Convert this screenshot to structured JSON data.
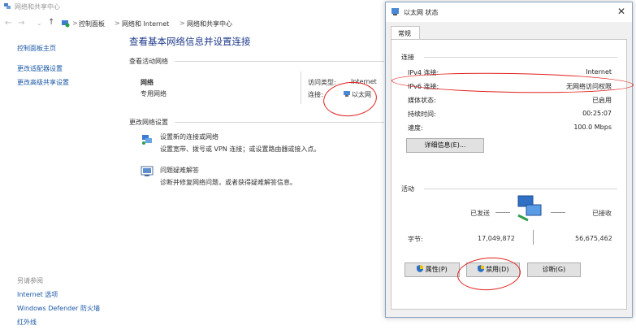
{
  "window": {
    "title": "网络和共享中心"
  },
  "breadcrumb": {
    "items": [
      "控制面板",
      "网络和 Internet",
      "网络和共享中心"
    ],
    "separator": ">"
  },
  "sidebar": {
    "items": [
      {
        "label": "控制面板主页"
      },
      {
        "label": "更改适配器设置"
      },
      {
        "label": "更改高级共享设置"
      }
    ],
    "see_also": {
      "title": "另请参阅",
      "items": [
        {
          "label": "Internet 选项"
        },
        {
          "label": "Windows Defender 防火墙"
        },
        {
          "label": "红外线"
        }
      ]
    }
  },
  "main": {
    "heading": "查看基本网络信息并设置连接",
    "active_networks_label": "查看活动网络",
    "network": {
      "name": "网络",
      "type": "专用网络",
      "access_type_label": "访问类型:",
      "access_type_value": "Internet",
      "connections_label": "连接:",
      "connections_value": "以太网"
    },
    "change_settings_label": "更改网络设置",
    "actions": [
      {
        "title": "设置新的连接或网络",
        "desc": "设置宽带、拨号或 VPN 连接；或设置路由器或接入点。"
      },
      {
        "title": "问题疑难解答",
        "desc": "诊断并修复网络问题，或者获得疑难解答信息。"
      }
    ]
  },
  "dialog": {
    "title": "以太网 状态",
    "tab": "常规",
    "connection_group": "连接",
    "rows": [
      {
        "label": "IPv4 连接:",
        "value": "Internet"
      },
      {
        "label": "IPv6 连接:",
        "value": "无网络访问权限"
      },
      {
        "label": "媒体状态:",
        "value": "已启用"
      },
      {
        "label": "持续时间:",
        "value": "00:25:07"
      },
      {
        "label": "速度:",
        "value": "100.0 Mbps"
      }
    ],
    "details_button": "详细信息(E)...",
    "activity_group": "活动",
    "sent_label": "已发送",
    "received_label": "已接收",
    "bytes_label": "字节:",
    "bytes_sent": "17,049,872",
    "bytes_received": "56,675,462",
    "buttons": {
      "properties": "属性(P)",
      "disable": "禁用(D)",
      "diagnose": "诊断(G)"
    }
  },
  "colors": {
    "link": "#1b58a6",
    "heading": "#1e3a8a",
    "annotation": "#e0201c"
  }
}
